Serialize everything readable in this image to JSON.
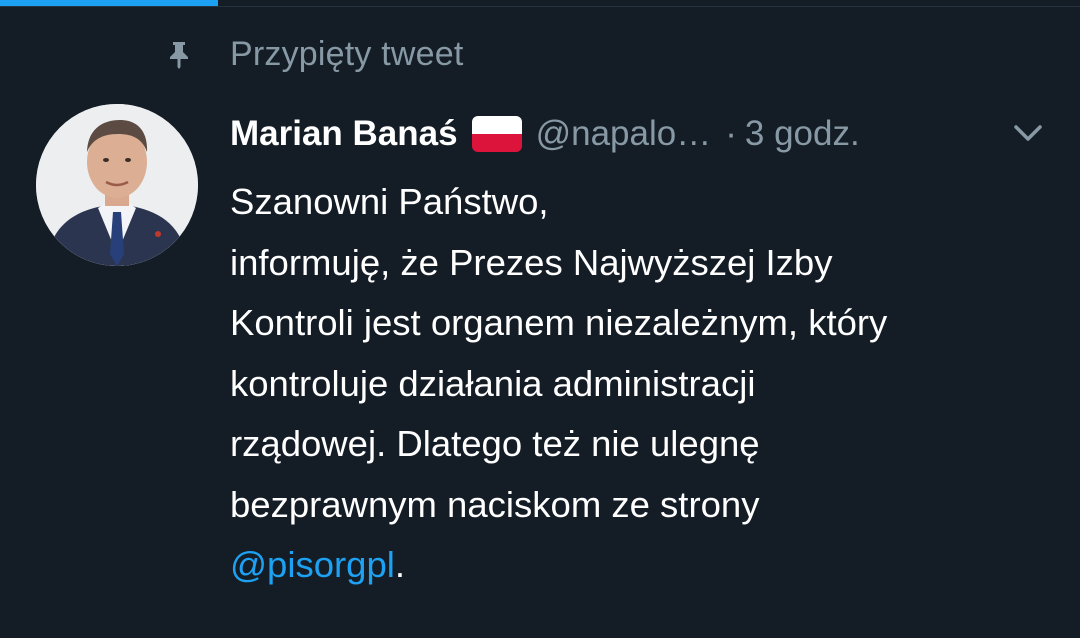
{
  "pinned": {
    "label": "Przypięty tweet",
    "icon": "pin-icon"
  },
  "tweet": {
    "author_name": "Marian Banaś",
    "flag_icon": "poland-flag-icon",
    "handle": "@napalo…",
    "separator": "·",
    "time": "3 godz.",
    "menu_icon": "chevron-down-icon",
    "lines": [
      "Szanowni Państwo,",
      "informuję, że Prezes Najwyższej Izby",
      "Kontroli jest organem niezależnym, który",
      "kontroluje działania administracji",
      "rządowej. Dlatego też nie ulegnę",
      "bezprawnym naciskom ze strony"
    ],
    "mention": "@pisorgpl",
    "mention_suffix": "."
  },
  "colors": {
    "background": "#141d26",
    "text": "#ffffff",
    "muted": "#8899a6",
    "accent": "#1da1f2"
  }
}
